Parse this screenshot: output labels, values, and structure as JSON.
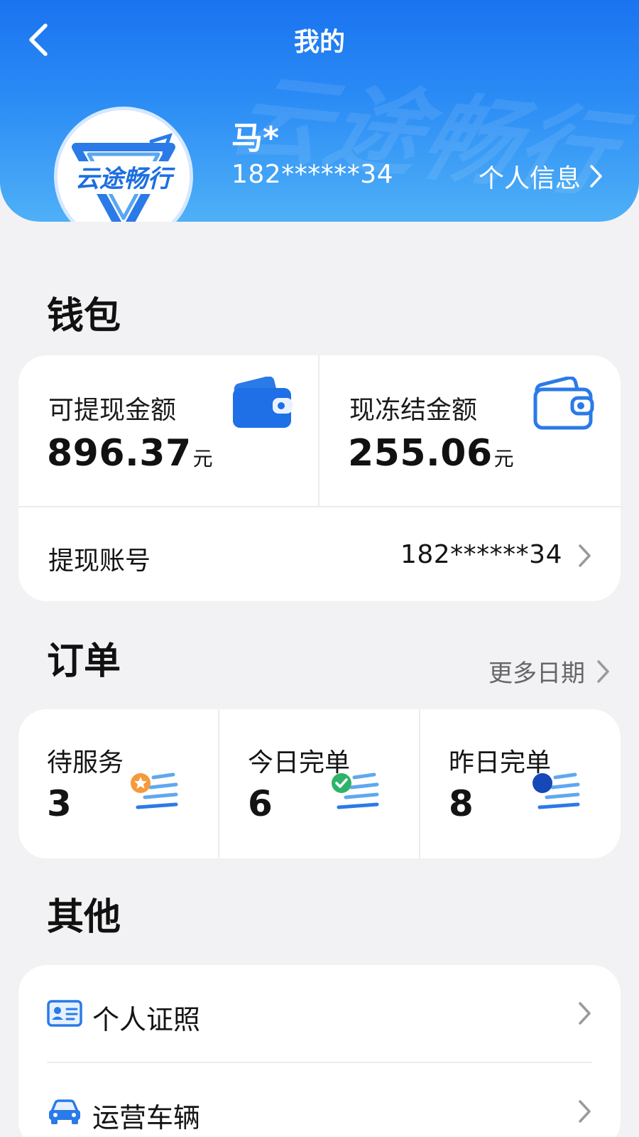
{
  "header": {
    "title": "我的",
    "watermark": "云途畅行",
    "logo_text": "云途畅行",
    "user_name": "马*",
    "user_phone": "182******34",
    "personal_info_label": "个人信息"
  },
  "wallet": {
    "title": "钱包",
    "withdrawable_label": "可提现金额",
    "withdrawable_amount": "896.37",
    "frozen_label": "现冻结金额",
    "frozen_amount": "255.06",
    "currency_unit": "元",
    "withdraw_account_label": "提现账号",
    "withdraw_account_value": "182******34"
  },
  "orders": {
    "title": "订单",
    "more_dates_label": "更多日期",
    "items": [
      {
        "label": "待服务",
        "count": "3"
      },
      {
        "label": "今日完单",
        "count": "6"
      },
      {
        "label": "昨日完单",
        "count": "8"
      }
    ]
  },
  "other": {
    "title": "其他",
    "items": [
      {
        "label": "个人证照"
      },
      {
        "label": "运营车辆"
      }
    ]
  },
  "colors": {
    "brand_blue": "#1a73f0",
    "header_light": "#4fb0f7",
    "background": "#f2f2f4",
    "star_orange": "#f59a3a",
    "check_green": "#2fb36a"
  }
}
